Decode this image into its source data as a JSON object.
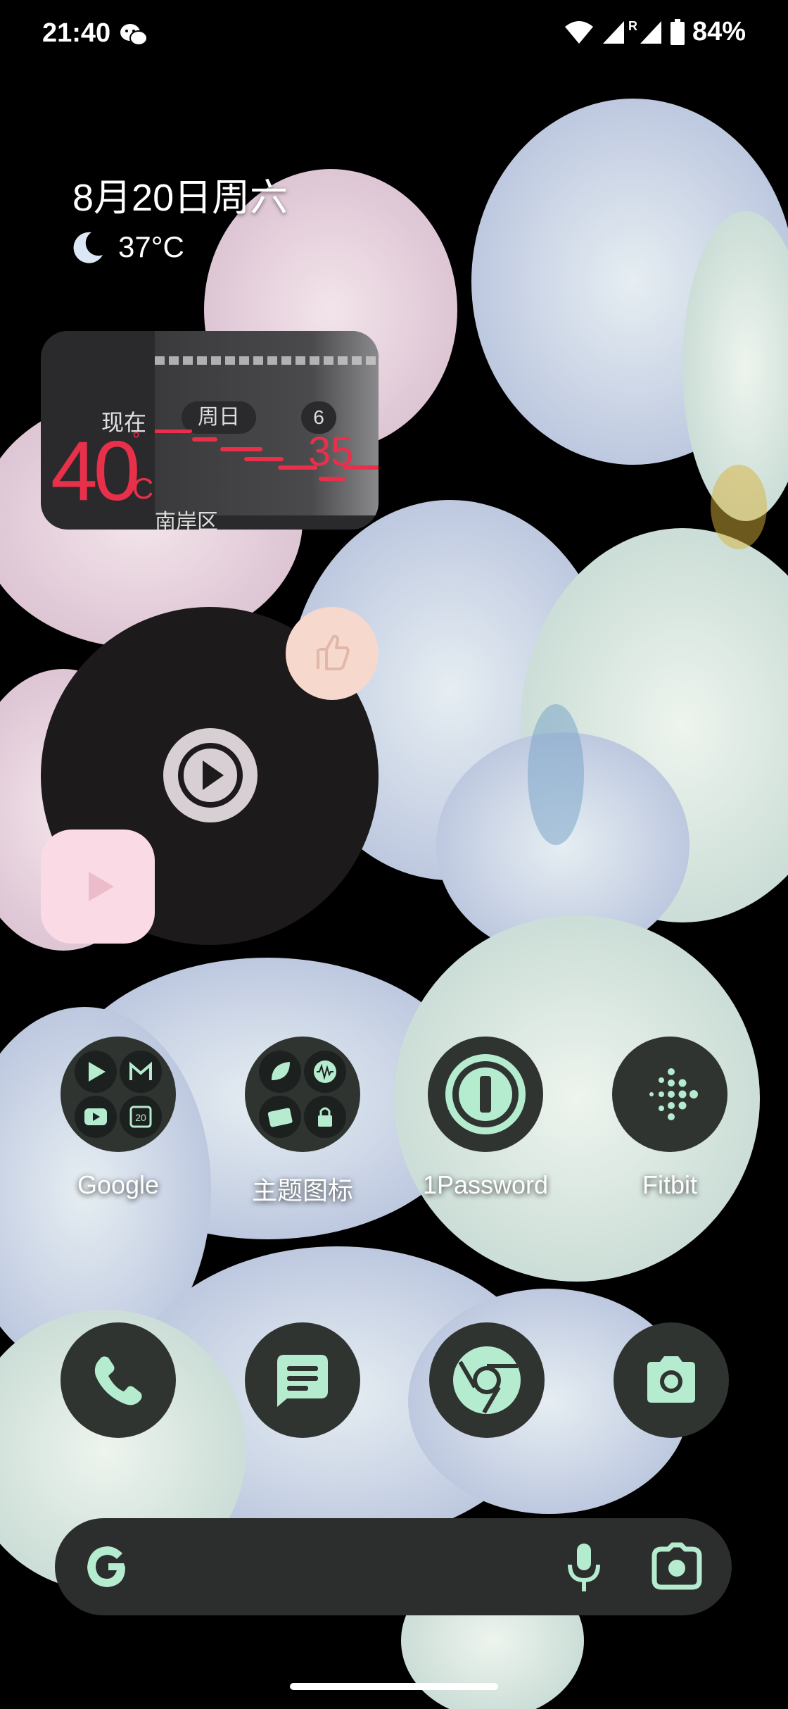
{
  "status_bar": {
    "time": "21:40",
    "roaming_label": "R",
    "battery": "84%",
    "icons": [
      "wechat-icon",
      "wifi-icon",
      "signal-icon",
      "battery-icon"
    ]
  },
  "at_a_glance": {
    "date": "8月20日周六",
    "temperature": "37°C",
    "weather_icon": "moon-icon"
  },
  "weather_widget": {
    "now_label": "现在",
    "current_temp": "40",
    "degree_mark": "°",
    "unit": "C",
    "day_label": "周日",
    "hour_label": "6",
    "forecast_temp": "35",
    "area": "南岸区"
  },
  "apps": [
    {
      "label": "Google",
      "type": "folder"
    },
    {
      "label": "主题图标",
      "type": "folder"
    },
    {
      "label": "1Password",
      "type": "app"
    },
    {
      "label": "Fitbit",
      "type": "app"
    }
  ],
  "dock": [
    "phone-icon",
    "messages-icon",
    "chrome-icon",
    "camera-icon"
  ],
  "search": {
    "icons": [
      "google-g-icon",
      "microphone-icon",
      "lens-icon"
    ]
  },
  "colors": {
    "accent": "#b5ecd0",
    "icon_bg": "#2f3431",
    "weather_red": "#e8304a"
  }
}
